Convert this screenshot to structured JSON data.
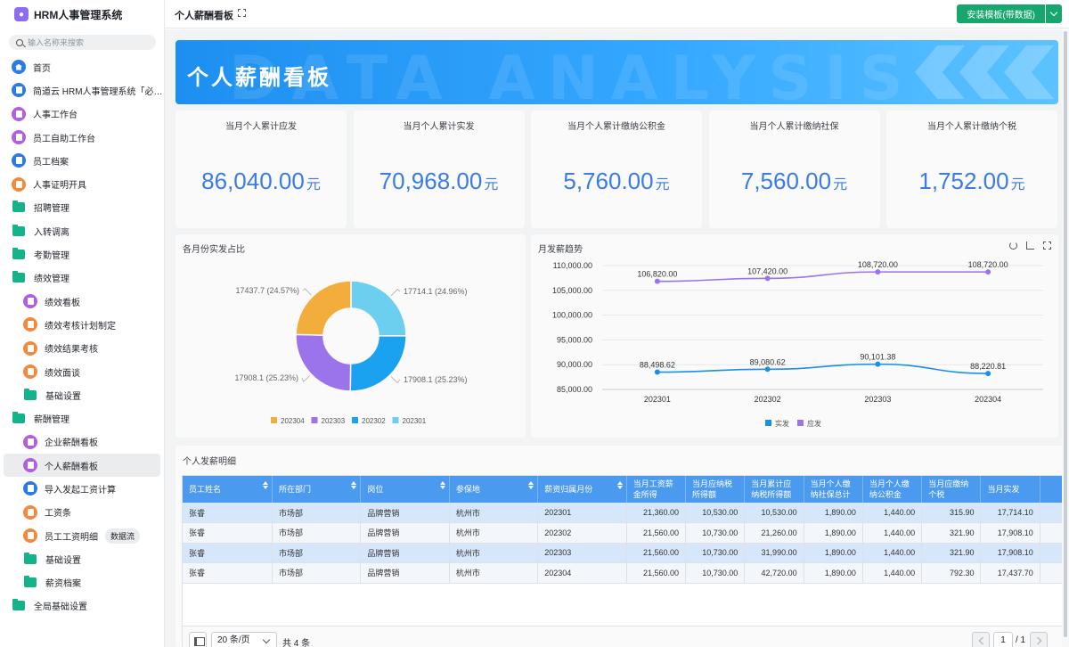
{
  "app": {
    "title": "HRM人事管理系统",
    "search_placeholder": "输入名称来搜索"
  },
  "sidebar": {
    "items": [
      {
        "label": "首页",
        "icon": "home-icon",
        "type": "app",
        "color": "#2a7be6"
      },
      {
        "label": "简道云 HRM人事管理系统「必…",
        "icon": "doc-icon",
        "type": "app",
        "color": "#2a7be6"
      },
      {
        "label": "人事工作台",
        "icon": "dashboard-icon",
        "type": "app",
        "color": "#b15ee0"
      },
      {
        "label": "员工自助工作台",
        "icon": "dashboard-icon",
        "type": "app",
        "color": "#b15ee0"
      },
      {
        "label": "员工档案",
        "icon": "doc-icon",
        "type": "app",
        "color": "#2a7be6"
      },
      {
        "label": "人事证明开具",
        "icon": "doc-icon",
        "type": "app",
        "color": "#f7883a"
      },
      {
        "label": "招聘管理",
        "icon": "folder-icon",
        "type": "folder"
      },
      {
        "label": "入转调离",
        "icon": "folder-icon",
        "type": "folder"
      },
      {
        "label": "考勤管理",
        "icon": "folder-icon",
        "type": "folder"
      },
      {
        "label": "绩效管理",
        "icon": "folder-icon",
        "type": "folder"
      },
      {
        "label": "绩效看板",
        "icon": "dashboard-icon",
        "type": "child",
        "color": "#b15ee0"
      },
      {
        "label": "绩效考核计划制定",
        "icon": "doc-icon",
        "type": "child",
        "color": "#f7883a"
      },
      {
        "label": "绩效结果考核",
        "icon": "doc-icon",
        "type": "child",
        "color": "#f7883a"
      },
      {
        "label": "绩效面谈",
        "icon": "doc-icon",
        "type": "child",
        "color": "#f7883a"
      },
      {
        "label": "基础设置",
        "icon": "folder-icon",
        "type": "child-folder"
      },
      {
        "label": "薪酬管理",
        "icon": "folder-icon",
        "type": "folder"
      },
      {
        "label": "企业薪酬看板",
        "icon": "dashboard-icon",
        "type": "child",
        "color": "#b15ee0"
      },
      {
        "label": "个人薪酬看板",
        "icon": "dashboard-icon",
        "type": "child",
        "color": "#b15ee0",
        "active": true
      },
      {
        "label": "导入发起工资计算",
        "icon": "doc-icon",
        "type": "child",
        "color": "#2a7be6"
      },
      {
        "label": "工资条",
        "icon": "doc-icon",
        "type": "child",
        "color": "#f7883a"
      },
      {
        "label": "员工工资明细",
        "icon": "doc-icon",
        "type": "child",
        "color": "#f7883a",
        "tag": "数据流"
      },
      {
        "label": "基础设置",
        "icon": "folder-icon",
        "type": "child-folder"
      },
      {
        "label": "薪资档案",
        "icon": "folder-icon",
        "type": "child-folder"
      },
      {
        "label": "全局基础设置",
        "icon": "folder-icon",
        "type": "folder"
      }
    ]
  },
  "topbar": {
    "page_title": "个人薪酬看板",
    "install_label": "安装模板(带数据)"
  },
  "banner": {
    "title": "个人薪酬看板",
    "bg_text": "DATA ANALYSIS"
  },
  "kpis": [
    {
      "label": "当月个人累计应发",
      "value": "86,040.00",
      "unit": "元"
    },
    {
      "label": "当月个人累计实发",
      "value": "70,968.00",
      "unit": "元"
    },
    {
      "label": "当月个人累计缴纳公积金",
      "value": "5,760.00",
      "unit": "元"
    },
    {
      "label": "当月个人累计缴纳社保",
      "value": "7,560.00",
      "unit": "元"
    },
    {
      "label": "当月个人累计缴纳个税",
      "value": "1,752.00",
      "unit": "元"
    }
  ],
  "donut_panel": {
    "title": "各月份实发占比"
  },
  "line_panel": {
    "title": "月发薪趋势"
  },
  "table_panel": {
    "title": "个人发薪明细"
  },
  "chart_data": [
    {
      "type": "pie",
      "title": "各月份实发占比",
      "donut": true,
      "categories": [
        "202301",
        "202302",
        "202303",
        "202304"
      ],
      "values": [
        17714.1,
        17908.1,
        17908.1,
        17437.7
      ],
      "labels": [
        "17714.1 (24.96%)",
        "17908.1 (25.23%)",
        "17908.1 (25.23%)",
        "17437.7 (24.57%)"
      ],
      "colors": [
        "#6ccfef",
        "#1aa1f0",
        "#9b74ec",
        "#f3ad3c"
      ],
      "legend": [
        "202304",
        "202303",
        "202302",
        "202301"
      ],
      "legend_colors": [
        "#f3ad3c",
        "#9b74ec",
        "#1aa1f0",
        "#6ccfef"
      ],
      "legend_position": "bottom"
    },
    {
      "type": "line",
      "title": "月发薪趋势",
      "categories": [
        "202301",
        "202302",
        "202303",
        "202304"
      ],
      "ylim": [
        85000,
        110000
      ],
      "yticks": [
        "110,000.00",
        "105,000.00",
        "100,000.00",
        "95,000.00",
        "90,000.00",
        "85,000.00"
      ],
      "ytick_values": [
        110000,
        105000,
        100000,
        95000,
        90000,
        85000
      ],
      "series": [
        {
          "name": "应发",
          "values": [
            106820,
            107420,
            108720,
            108720
          ],
          "labels": [
            "106,820.00",
            "107,420.00",
            "108,720.00",
            "108,720.00"
          ],
          "color": "#9b74ec"
        },
        {
          "name": "实发",
          "values": [
            88498.62,
            89080.62,
            90101.38,
            88220.81
          ],
          "labels": [
            "88,498.62",
            "89,080.62",
            "90,101.38",
            "88,220.81"
          ],
          "color": "#1a8fe6"
        }
      ],
      "legend": [
        "实发",
        "应发"
      ],
      "legend_colors": [
        "#1a8fe6",
        "#9b74ec"
      ],
      "legend_position": "bottom",
      "grid": "horizontal"
    }
  ],
  "table": {
    "headers": [
      "员工姓名",
      "所在部门",
      "岗位",
      "参保地",
      "薪资归属月份",
      "当月工资薪金所得",
      "当月应纳税所得额",
      "当月累计应纳税所得额",
      "当月个人缴纳社保总计",
      "当月个人缴纳公积金",
      "当月应缴纳个税",
      "当月实发"
    ],
    "rows": [
      [
        "张睿",
        "市场部",
        "品牌营销",
        "杭州市",
        "202301",
        "21,360.00",
        "10,530.00",
        "10,530.00",
        "1,890.00",
        "1,440.00",
        "315.90",
        "17,714.10"
      ],
      [
        "张睿",
        "市场部",
        "品牌营销",
        "杭州市",
        "202302",
        "21,560.00",
        "10,730.00",
        "21,260.00",
        "1,890.00",
        "1,440.00",
        "321.90",
        "17,908.10"
      ],
      [
        "张睿",
        "市场部",
        "品牌营销",
        "杭州市",
        "202303",
        "21,560.00",
        "10,730.00",
        "31,990.00",
        "1,890.00",
        "1,440.00",
        "321.90",
        "17,908.10"
      ],
      [
        "张睿",
        "市场部",
        "品牌营销",
        "杭州市",
        "202304",
        "21,560.00",
        "10,730.00",
        "42,720.00",
        "1,890.00",
        "1,440.00",
        "792.30",
        "17,437.70"
      ]
    ]
  },
  "pager": {
    "page_size": "20 条/页",
    "total": "共 4 条",
    "page": "1",
    "page_count": "/ 1"
  }
}
